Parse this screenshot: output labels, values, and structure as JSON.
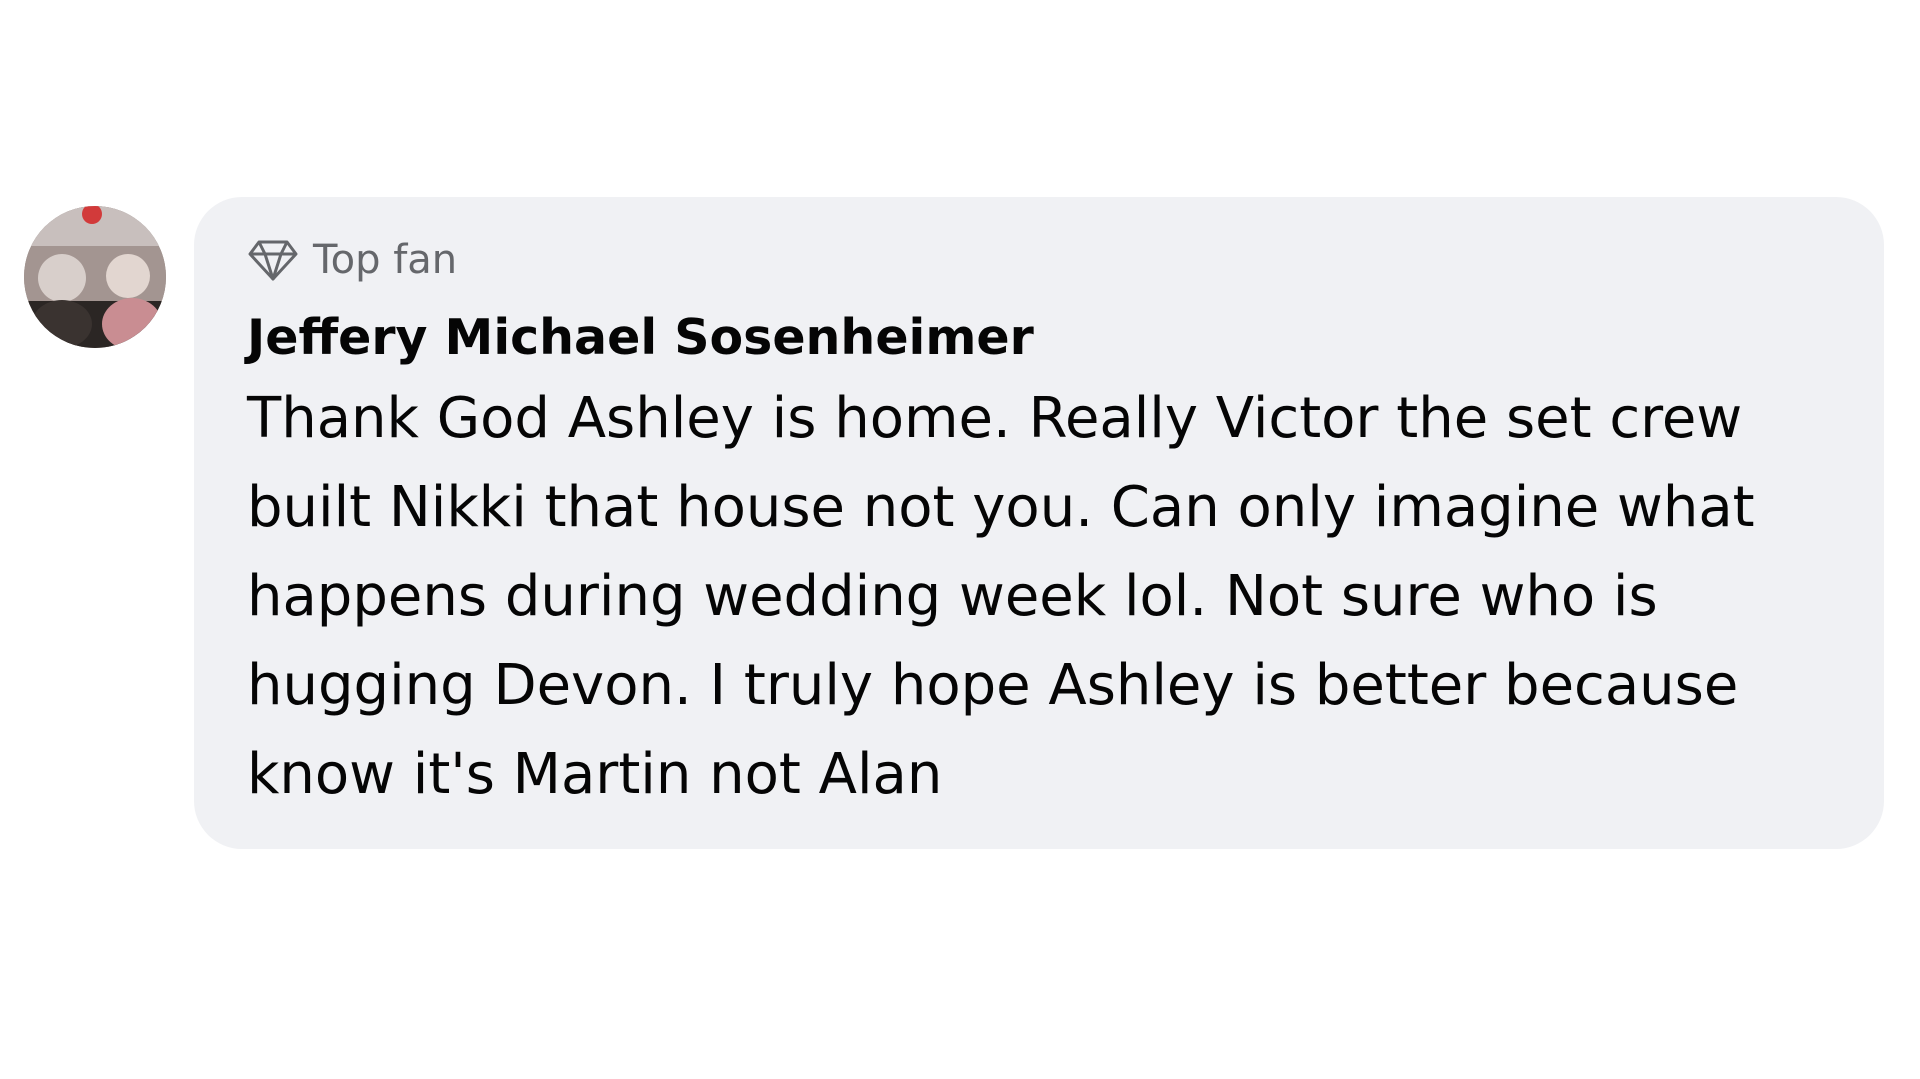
{
  "comment": {
    "badge": {
      "icon": "diamond-icon",
      "label": "Top fan"
    },
    "author": "Jeffery Michael Sosenheimer",
    "text": "Thank God Ashley is home. Really Victor the set crew built Nikki that house not you. Can only imagine what happens during wedding week lol. Not sure who is hugging Devon. I truly hope Ashley is better because know it's Martin not Alan"
  },
  "colors": {
    "bubble_background": "#f0f1f4",
    "text": "#050505",
    "secondary_text": "#65676b"
  }
}
